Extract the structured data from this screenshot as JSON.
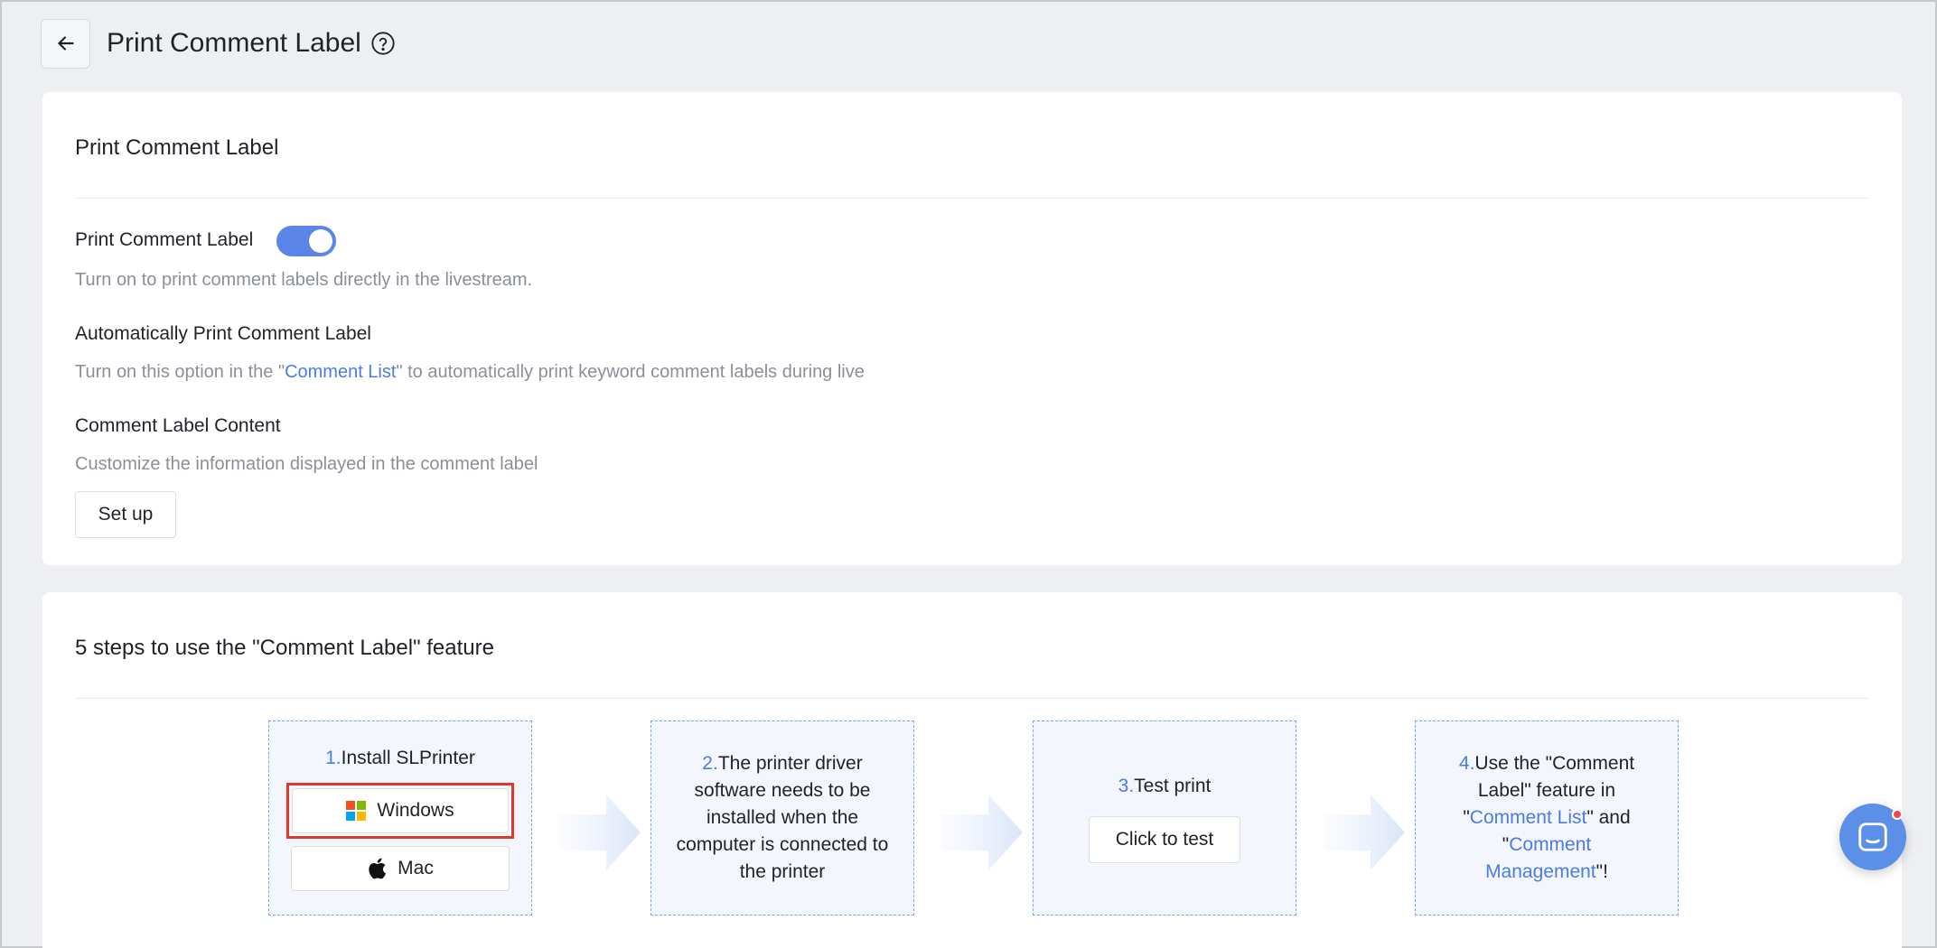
{
  "header": {
    "title": "Print Comment Label"
  },
  "settings": {
    "title": "Print Comment Label",
    "toggle_label": "Print Comment Label",
    "toggle_on": true,
    "toggle_desc": "Turn on to print comment labels directly in the livestream.",
    "auto_label": "Automatically Print Comment Label",
    "auto_desc_prefix": "Turn on this option in the \"",
    "auto_desc_link": "Comment List",
    "auto_desc_suffix": "\" to automatically print keyword comment labels during live",
    "content_label": "Comment Label Content",
    "content_desc": "Customize the information displayed in the comment label",
    "setup_button": "Set up"
  },
  "steps": {
    "title": "5 steps to use the \"Comment Label\" feature",
    "step1": {
      "num": "1.",
      "text": "Install SLPrinter",
      "windows": "Windows",
      "mac": "Mac"
    },
    "step2": {
      "num": "2.",
      "text": "The printer driver software needs to be installed when the computer is connected to the printer"
    },
    "step3": {
      "num": "3.",
      "text": "Test print",
      "button": "Click to test"
    },
    "step4": {
      "num": "4.",
      "text_a": "Use the \"Comment Label\" feature in \"",
      "link1": "Comment List",
      "text_b": "\" and \"",
      "link2": "Comment Management",
      "text_c": "\"!"
    }
  },
  "colors": {
    "accent": "#4b7be5",
    "toggle": "#5b85e8",
    "highlight": "#e0392b"
  },
  "icons": [
    "back-arrow-icon",
    "help-circle-icon",
    "windows-icon",
    "apple-icon",
    "chevron-arrow-icon",
    "chat-icon"
  ]
}
